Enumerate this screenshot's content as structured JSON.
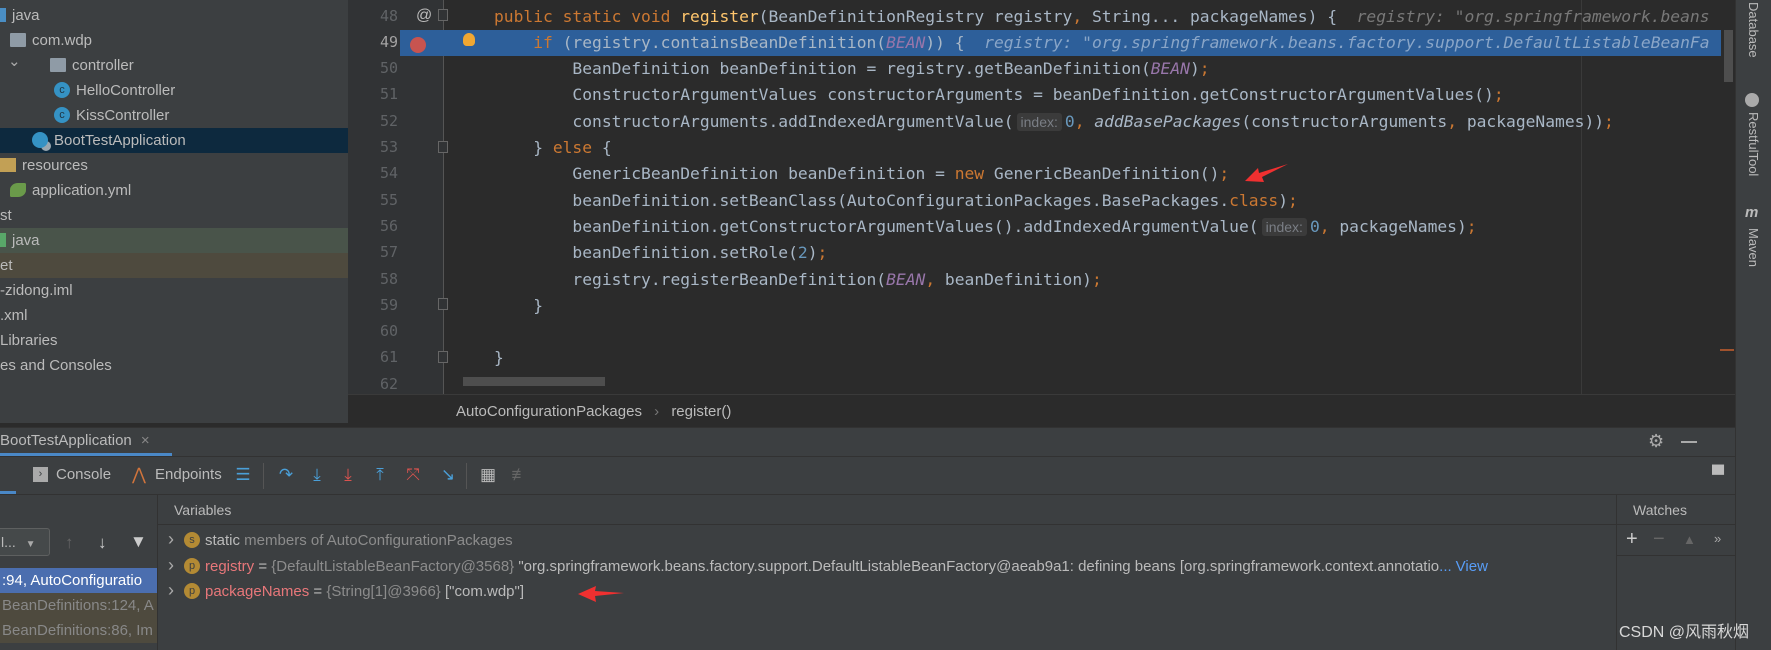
{
  "project_tree": [
    {
      "label": "java",
      "icon": "source-root-icon",
      "indent": 0
    },
    {
      "label": "com.wdp",
      "icon": "package-icon",
      "indent": 10
    },
    {
      "label": "controller",
      "icon": "package-icon",
      "indent": 50,
      "expanded": true
    },
    {
      "label": "HelloController",
      "icon": "class-icon",
      "indent": 54
    },
    {
      "label": "KissController",
      "icon": "class-icon",
      "indent": 54
    },
    {
      "label": "BootTestApplication",
      "icon": "spring-app-icon",
      "indent": 32,
      "selected": true
    },
    {
      "label": "resources",
      "icon": "resources-icon",
      "indent": 0
    },
    {
      "label": "application.yml",
      "icon": "yml-icon",
      "indent": 10
    },
    {
      "label": "st",
      "icon": "",
      "indent": 0
    },
    {
      "label": "java",
      "icon": "test-root-icon",
      "indent": 0,
      "bg": "#49544a"
    },
    {
      "label": "et",
      "icon": "",
      "indent": 0,
      "bg": "#4e4a3e"
    },
    {
      "label": "-zidong.iml",
      "icon": "",
      "indent": 0
    },
    {
      "label": ".xml",
      "icon": "",
      "indent": 0
    },
    {
      "label": " Libraries",
      "icon": "",
      "indent": 0
    },
    {
      "label": "es and Consoles",
      "icon": "",
      "indent": 0
    }
  ],
  "editor": {
    "current_line": 49,
    "lines": [
      {
        "n": "48",
        "tokens": [
          [
            "kw",
            "public static void "
          ],
          [
            "fn",
            "register"
          ],
          [
            "",
            "(BeanDefinitionRegistry registry"
          ],
          [
            "kw",
            ", "
          ],
          [
            "",
            "String... packageNames) {"
          ],
          [
            "hint",
            "  registry: \"org.springframework.beans"
          ]
        ]
      },
      {
        "n": "49",
        "tokens": [
          [
            "",
            "    "
          ],
          [
            "kw",
            "if"
          ],
          [
            "",
            " (registry.containsBeanDefinition("
          ],
          [
            "cst",
            "BEAN"
          ],
          [
            "",
            ")) {"
          ],
          [
            "hint",
            "  registry: \"org.springframework.beans.factory.support.DefaultListableBeanFa"
          ]
        ]
      },
      {
        "n": "50",
        "tokens": [
          [
            "",
            "        BeanDefinition beanDefinition = registry.getBeanDefinition("
          ],
          [
            "cst",
            "BEAN"
          ],
          [
            "",
            ")"
          ],
          [
            "kw",
            ";"
          ]
        ]
      },
      {
        "n": "51",
        "tokens": [
          [
            "",
            "        ConstructorArgumentValues constructorArguments = beanDefinition.getConstructorArgumentValues()"
          ],
          [
            "kw",
            ";"
          ]
        ]
      },
      {
        "n": "52",
        "tokens": [
          [
            "",
            "        constructorArguments.addIndexedArgumentValue("
          ],
          [
            "inlay",
            "index:"
          ],
          [
            "num",
            "0"
          ],
          [
            "kw",
            ", "
          ],
          [
            "it",
            "addBasePackages"
          ],
          [
            "",
            "(constructorArguments"
          ],
          [
            "kw",
            ", "
          ],
          [
            "",
            "packageNames))"
          ],
          [
            "kw",
            ";"
          ]
        ]
      },
      {
        "n": "53",
        "tokens": [
          [
            "",
            "    } "
          ],
          [
            "kw",
            "else"
          ],
          [
            "",
            " {"
          ]
        ]
      },
      {
        "n": "54",
        "tokens": [
          [
            "",
            "        GenericBeanDefinition beanDefinition = "
          ],
          [
            "kw",
            "new"
          ],
          [
            "",
            " GenericBeanDefinition()"
          ],
          [
            "kw",
            ";"
          ]
        ]
      },
      {
        "n": "55",
        "tokens": [
          [
            "",
            "        beanDefinition.setBeanClass(AutoConfigurationPackages.BasePackages."
          ],
          [
            "kw",
            "class"
          ],
          [
            "",
            ")"
          ],
          [
            "kw",
            ";"
          ]
        ]
      },
      {
        "n": "56",
        "tokens": [
          [
            "",
            "        beanDefinition.getConstructorArgumentValues().addIndexedArgumentValue("
          ],
          [
            "inlay",
            "index:"
          ],
          [
            "num",
            "0"
          ],
          [
            "kw",
            ", "
          ],
          [
            "",
            "packageNames)"
          ],
          [
            "kw",
            ";"
          ]
        ]
      },
      {
        "n": "57",
        "tokens": [
          [
            "",
            "        beanDefinition.setRole("
          ],
          [
            "num",
            "2"
          ],
          [
            "",
            ")"
          ],
          [
            "kw",
            ";"
          ]
        ]
      },
      {
        "n": "58",
        "tokens": [
          [
            "",
            "        registry.registerBeanDefinition("
          ],
          [
            "cst",
            "BEAN"
          ],
          [
            "kw",
            ", "
          ],
          [
            "",
            "beanDefinition)"
          ],
          [
            "kw",
            ";"
          ]
        ]
      },
      {
        "n": "59",
        "tokens": [
          [
            "",
            "    }"
          ]
        ]
      },
      {
        "n": "60",
        "tokens": []
      },
      {
        "n": "61",
        "tokens": [
          [
            "",
            "}"
          ]
        ]
      },
      {
        "n": "62",
        "tokens": []
      }
    ]
  },
  "breadcrumb": {
    "class": "AutoConfigurationPackages",
    "method": "register()"
  },
  "debug": {
    "tab_label": "BootTestApplication",
    "console_label": "Console",
    "endpoints_label": "Endpoints",
    "variables_header": "Variables",
    "watches_header": "Watches",
    "thread_dropdown": "l...",
    "frames": [
      ":94, AutoConfiguratio",
      "BeanDefinitions:124, A",
      "BeanDefinitions:86, Im"
    ],
    "variables": [
      {
        "badge": "s",
        "name": "static",
        "rest": " members of AutoConfigurationPackages",
        "static": true
      },
      {
        "badge": "p",
        "name": "registry",
        "type": "{DefaultListableBeanFactory@3568}",
        "value": " \"org.springframework.beans.factory.support.DefaultListableBeanFactory@aeab9a1: defining beans [org.springframework.context.annotatio",
        "ellipsis": "...",
        "link": "View"
      },
      {
        "badge": "p",
        "name": "packageNames",
        "type": "{String[1]@3966}",
        "value": " [\"com.wdp\"]"
      }
    ]
  },
  "right_sidebar": [
    "Database",
    "RestfulTool",
    "Maven"
  ],
  "watermark": "CSDN @风雨秋烟",
  "colors": {
    "selection": "#2d5f9a",
    "accent_arrow": "#f03030",
    "keyword": "#cc7832"
  }
}
